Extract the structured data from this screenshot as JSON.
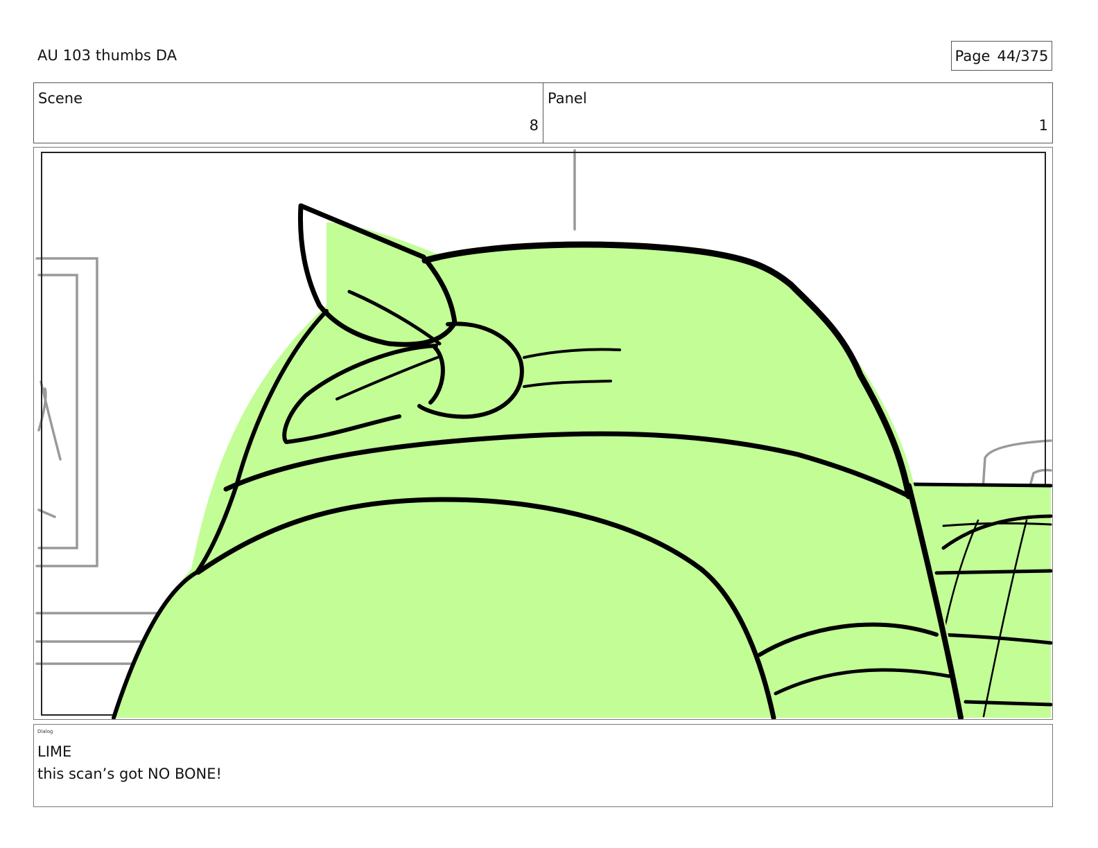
{
  "header": {
    "title": "AU 103 thumbs DA",
    "page_label": "Page",
    "page_number": "44/375"
  },
  "info": {
    "scene_label": "Scene",
    "scene_value": "8",
    "panel_label": "Panel",
    "panel_value": "1"
  },
  "artwork": {
    "fill_color": "#c2fd96",
    "ink_color": "#000000",
    "sketch_color": "#999999"
  },
  "dialog": {
    "label": "Dialog",
    "character": "LIME",
    "line": "this scan’s got NO BONE!"
  }
}
